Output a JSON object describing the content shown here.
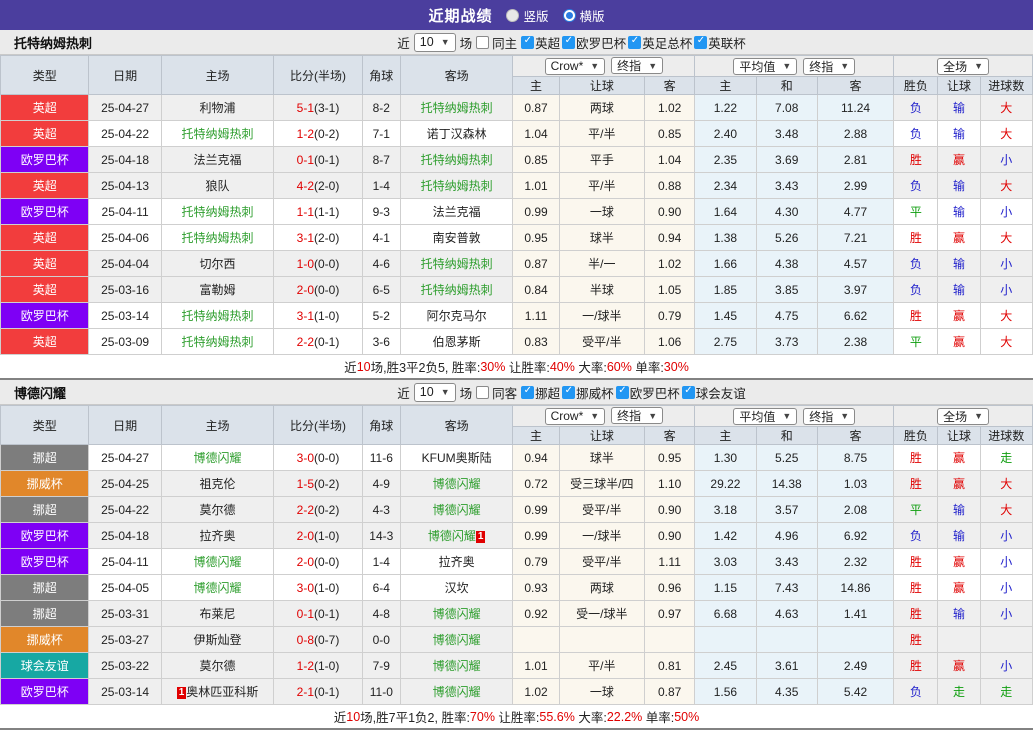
{
  "header": {
    "title": "近期战绩",
    "radios": [
      {
        "label": "竖版",
        "selected": false
      },
      {
        "label": "横版",
        "selected": true
      }
    ]
  },
  "table_header": {
    "col_type": "类型",
    "col_date": "日期",
    "col_home": "主场",
    "col_score": "比分(半场)",
    "col_corner": "角球",
    "col_away": "客场",
    "odds_source_select": "Crow*",
    "odds_final_select": "终指",
    "avg_select": "平均值",
    "avg_final_select": "终指",
    "scope_select": "全场",
    "sub": [
      "主",
      "让球",
      "客",
      "主",
      "和",
      "客",
      "胜负",
      "让球",
      "进球数"
    ]
  },
  "colors": {
    "accent_purple": "#4b3e9e",
    "focal_team": "#2e9e2e",
    "score_red": "#e00000",
    "checkbox_blue": "#2196f3",
    "leagues": {
      "英超": "#f23d3d",
      "欧罗巴杯": "#7e00f5",
      "挪超": "#7d7d7d",
      "挪威杯": "#e1872a",
      "球会友谊": "#17a8a3"
    },
    "results": {
      "胜": "#e00000",
      "赢": "#e00000",
      "大": "#e00000",
      "负": "#2222cc",
      "输": "#2222cc",
      "小": "#2222cc",
      "平": "#0f9e0f",
      "走": "#0f9e0f"
    }
  },
  "sections": [
    {
      "team": "托特纳姆热刺",
      "filter": {
        "near_label": "近",
        "games": "10",
        "games_unit": "场",
        "same_label": "同主",
        "same_checked": false,
        "leagues": [
          {
            "label": "英超",
            "checked": true
          },
          {
            "label": "欧罗巴杯",
            "checked": true
          },
          {
            "label": "英足总杯",
            "checked": true
          },
          {
            "label": "英联杯",
            "checked": true
          }
        ]
      },
      "rows": [
        {
          "league": "英超",
          "date": "25-04-27",
          "home": "利物浦",
          "score": "5-1",
          "half": "(3-1)",
          "corner": "8-2",
          "away": "托特纳姆热刺",
          "o1": "0.87",
          "o2": "两球",
          "o3": "1.02",
          "o4": "1.22",
          "o5": "7.08",
          "o6": "11.24",
          "r1": "负",
          "r2": "输",
          "r3": "大"
        },
        {
          "league": "英超",
          "date": "25-04-22",
          "home": "托特纳姆热刺",
          "score": "1-2",
          "half": "(0-2)",
          "corner": "7-1",
          "away": "诺丁汉森林",
          "o1": "1.04",
          "o2": "平/半",
          "o3": "0.85",
          "o4": "2.40",
          "o5": "3.48",
          "o6": "2.88",
          "r1": "负",
          "r2": "输",
          "r3": "大"
        },
        {
          "league": "欧罗巴杯",
          "date": "25-04-18",
          "home": "法兰克福",
          "score": "0-1",
          "half": "(0-1)",
          "corner": "8-7",
          "away": "托特纳姆热刺",
          "o1": "0.85",
          "o2": "平手",
          "o3": "1.04",
          "o4": "2.35",
          "o5": "3.69",
          "o6": "2.81",
          "r1": "胜",
          "r2": "赢",
          "r3": "小"
        },
        {
          "league": "英超",
          "date": "25-04-13",
          "home": "狼队",
          "score": "4-2",
          "half": "(2-0)",
          "corner": "1-4",
          "away": "托特纳姆热刺",
          "o1": "1.01",
          "o2": "平/半",
          "o3": "0.88",
          "o4": "2.34",
          "o5": "3.43",
          "o6": "2.99",
          "r1": "负",
          "r2": "输",
          "r3": "大"
        },
        {
          "league": "欧罗巴杯",
          "date": "25-04-11",
          "home": "托特纳姆热刺",
          "score": "1-1",
          "half": "(1-1)",
          "corner": "9-3",
          "away": "法兰克福",
          "o1": "0.99",
          "o2": "一球",
          "o3": "0.90",
          "o4": "1.64",
          "o5": "4.30",
          "o6": "4.77",
          "r1": "平",
          "r2": "输",
          "r3": "小"
        },
        {
          "league": "英超",
          "date": "25-04-06",
          "home": "托特纳姆热刺",
          "score": "3-1",
          "half": "(2-0)",
          "corner": "4-1",
          "away": "南安普敦",
          "o1": "0.95",
          "o2": "球半",
          "o3": "0.94",
          "o4": "1.38",
          "o5": "5.26",
          "o6": "7.21",
          "r1": "胜",
          "r2": "赢",
          "r3": "大"
        },
        {
          "league": "英超",
          "date": "25-04-04",
          "home": "切尔西",
          "score": "1-0",
          "half": "(0-0)",
          "corner": "4-6",
          "away": "托特纳姆热刺",
          "o1": "0.87",
          "o2": "半/一",
          "o3": "1.02",
          "o4": "1.66",
          "o5": "4.38",
          "o6": "4.57",
          "r1": "负",
          "r2": "输",
          "r3": "小"
        },
        {
          "league": "英超",
          "date": "25-03-16",
          "home": "富勒姆",
          "score": "2-0",
          "half": "(0-0)",
          "corner": "6-5",
          "away": "托特纳姆热刺",
          "o1": "0.84",
          "o2": "半球",
          "o3": "1.05",
          "o4": "1.85",
          "o5": "3.85",
          "o6": "3.97",
          "r1": "负",
          "r2": "输",
          "r3": "小"
        },
        {
          "league": "欧罗巴杯",
          "date": "25-03-14",
          "home": "托特纳姆热刺",
          "score": "3-1",
          "half": "(1-0)",
          "corner": "5-2",
          "away": "阿尔克马尔",
          "o1": "1.11",
          "o2": "一/球半",
          "o3": "0.79",
          "o4": "1.45",
          "o5": "4.75",
          "o6": "6.62",
          "r1": "胜",
          "r2": "赢",
          "r3": "大"
        },
        {
          "league": "英超",
          "date": "25-03-09",
          "home": "托特纳姆热刺",
          "score": "2-2",
          "half": "(0-1)",
          "corner": "3-6",
          "away": "伯恩茅斯",
          "o1": "0.83",
          "o2": "受平/半",
          "o3": "1.06",
          "o4": "2.75",
          "o5": "3.73",
          "o6": "2.38",
          "r1": "平",
          "r2": "赢",
          "r3": "大"
        }
      ],
      "summary": [
        {
          "t": "近"
        },
        {
          "t": "10",
          "red": true
        },
        {
          "t": "场,胜3平2负5, 胜率:"
        },
        {
          "t": "30%",
          "red": true
        },
        {
          "t": " 让胜率:"
        },
        {
          "t": "40%",
          "red": true
        },
        {
          "t": " 大率:"
        },
        {
          "t": "60%",
          "red": true
        },
        {
          "t": " 单率:"
        },
        {
          "t": "30%",
          "red": true
        }
      ]
    },
    {
      "team": "博德闪耀",
      "filter": {
        "near_label": "近",
        "games": "10",
        "games_unit": "场",
        "same_label": "同客",
        "same_checked": false,
        "leagues": [
          {
            "label": "挪超",
            "checked": true
          },
          {
            "label": "挪威杯",
            "checked": true
          },
          {
            "label": "欧罗巴杯",
            "checked": true
          },
          {
            "label": "球会友谊",
            "checked": true
          }
        ]
      },
      "rows": [
        {
          "league": "挪超",
          "date": "25-04-27",
          "home": "博德闪耀",
          "score": "3-0",
          "half": "(0-0)",
          "corner": "11-6",
          "away": "KFUM奥斯陆",
          "o1": "0.94",
          "o2": "球半",
          "o3": "0.95",
          "o4": "1.30",
          "o5": "5.25",
          "o6": "8.75",
          "r1": "胜",
          "r2": "赢",
          "r3": "走"
        },
        {
          "league": "挪威杯",
          "date": "25-04-25",
          "home": "祖克伦",
          "score": "1-5",
          "half": "(0-2)",
          "corner": "4-9",
          "away": "博德闪耀",
          "o1": "0.72",
          "o2": "受三球半/四",
          "o3": "1.10",
          "o4": "29.22",
          "o5": "14.38",
          "o6": "1.03",
          "r1": "胜",
          "r2": "赢",
          "r3": "大"
        },
        {
          "league": "挪超",
          "date": "25-04-22",
          "home": "莫尔德",
          "score": "2-2",
          "half": "(0-2)",
          "corner": "4-3",
          "away": "博德闪耀",
          "o1": "0.99",
          "o2": "受平/半",
          "o3": "0.90",
          "o4": "3.18",
          "o5": "3.57",
          "o6": "2.08",
          "r1": "平",
          "r2": "输",
          "r3": "大"
        },
        {
          "league": "欧罗巴杯",
          "date": "25-04-18",
          "home": "拉齐奥",
          "score": "2-0",
          "half": "(1-0)",
          "corner": "14-3",
          "away": "博德闪耀",
          "away_badge": "1",
          "o1": "0.99",
          "o2": "一/球半",
          "o3": "0.90",
          "o4": "1.42",
          "o5": "4.96",
          "o6": "6.92",
          "r1": "负",
          "r2": "输",
          "r3": "小"
        },
        {
          "league": "欧罗巴杯",
          "date": "25-04-11",
          "home": "博德闪耀",
          "score": "2-0",
          "half": "(0-0)",
          "corner": "1-4",
          "away": "拉齐奥",
          "o1": "0.79",
          "o2": "受平/半",
          "o3": "1.11",
          "o4": "3.03",
          "o5": "3.43",
          "o6": "2.32",
          "r1": "胜",
          "r2": "赢",
          "r3": "小"
        },
        {
          "league": "挪超",
          "date": "25-04-05",
          "home": "博德闪耀",
          "score": "3-0",
          "half": "(1-0)",
          "corner": "6-4",
          "away": "汉坎",
          "o1": "0.93",
          "o2": "两球",
          "o3": "0.96",
          "o4": "1.15",
          "o5": "7.43",
          "o6": "14.86",
          "r1": "胜",
          "r2": "赢",
          "r3": "小"
        },
        {
          "league": "挪超",
          "date": "25-03-31",
          "home": "布莱尼",
          "score": "0-1",
          "half": "(0-1)",
          "corner": "4-8",
          "away": "博德闪耀",
          "o1": "0.92",
          "o2": "受一/球半",
          "o3": "0.97",
          "o4": "6.68",
          "o5": "4.63",
          "o6": "1.41",
          "r1": "胜",
          "r2": "输",
          "r3": "小"
        },
        {
          "league": "挪威杯",
          "date": "25-03-27",
          "home": "伊斯灿登",
          "score": "0-8",
          "half": "(0-7)",
          "corner": "0-0",
          "away": "博德闪耀",
          "o1": "",
          "o2": "",
          "o3": "",
          "o4": "",
          "o5": "",
          "o6": "",
          "r1": "胜",
          "r2": "",
          "r3": ""
        },
        {
          "league": "球会友谊",
          "date": "25-03-22",
          "home": "莫尔德",
          "score": "1-2",
          "half": "(1-0)",
          "corner": "7-9",
          "away": "博德闪耀",
          "o1": "1.01",
          "o2": "平/半",
          "o3": "0.81",
          "o4": "2.45",
          "o5": "3.61",
          "o6": "2.49",
          "r1": "胜",
          "r2": "赢",
          "r3": "小"
        },
        {
          "league": "欧罗巴杯",
          "date": "25-03-14",
          "home": "奥林匹亚科斯",
          "home_badge": "1",
          "score": "2-1",
          "half": "(0-1)",
          "corner": "11-0",
          "away": "博德闪耀",
          "o1": "1.02",
          "o2": "一球",
          "o3": "0.87",
          "o4": "1.56",
          "o5": "4.35",
          "o6": "5.42",
          "r1": "负",
          "r2": "走",
          "r3": "走"
        }
      ],
      "summary": [
        {
          "t": "近"
        },
        {
          "t": "10",
          "red": true
        },
        {
          "t": "场,胜7平1负2, 胜率:"
        },
        {
          "t": "70%",
          "red": true
        },
        {
          "t": " 让胜率:"
        },
        {
          "t": "55.6%",
          "red": true
        },
        {
          "t": " 大率:"
        },
        {
          "t": "22.2%",
          "red": true
        },
        {
          "t": " 单率:"
        },
        {
          "t": "50%",
          "red": true
        }
      ]
    }
  ]
}
